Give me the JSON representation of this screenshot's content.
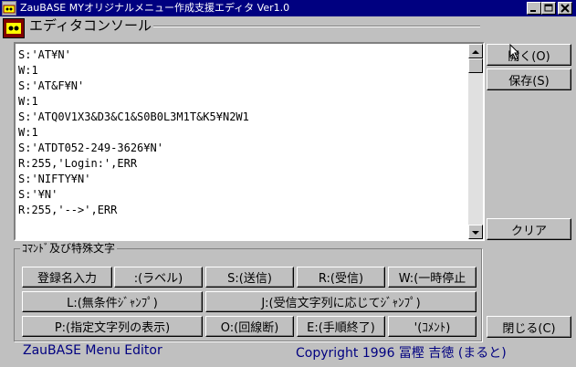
{
  "window": {
    "title": "ZauBASE MYオリジナルメニュー作成支援エディタ Ver1.0",
    "group_title": "エディタコンソール"
  },
  "editor": {
    "lines": [
      "S:'AT¥N'",
      "W:1",
      "S:'AT&F¥N'",
      "W:1",
      "S:'ATQ0V1X3&D3&C1&S0B0L3M1T&K5¥N2W1",
      "W:1",
      "S:'ATDT052-249-3626¥N'",
      "R:255,'Login:',ERR",
      "S:'NIFTY¥N'",
      "S:'¥N'",
      "R:255,'-->',ERR"
    ]
  },
  "side_buttons": {
    "open": "開く(O)",
    "save": "保存(S)",
    "clear": "クリア",
    "close": "閉じる(C)"
  },
  "commands": {
    "group_label": "ｺﾏﾝﾄﾞ及び特殊文字",
    "row1": [
      "登録名入力",
      ":(ラベル)",
      "S:(送信)",
      "R:(受信)",
      "W:(一時停止"
    ],
    "row2": [
      "L:(無条件ｼﾞｬﾝﾌﾟ)",
      "J:(受信文字列に応じてｼﾞｬﾝﾌﾟ)"
    ],
    "row3": [
      "P:(指定文字列の表示)",
      "O:(回線断)",
      "E:(手順終了)",
      "'(ｺﾒﾝﾄ)"
    ]
  },
  "footer": {
    "left": "ZauBASE Menu Editor",
    "right": "Copyright 1996 冨樫 吉徳 (まると)"
  },
  "colors": {
    "titlebar": "#000080",
    "face": "#c0c0c0",
    "footer_text": "#000080",
    "icon_bg": "#800000"
  },
  "icons": [
    "app-icon",
    "minimize-icon",
    "maximize-icon",
    "close-icon",
    "system-menu-icon",
    "scroll-up-icon",
    "scroll-down-icon",
    "mouse-pointer-icon"
  ]
}
